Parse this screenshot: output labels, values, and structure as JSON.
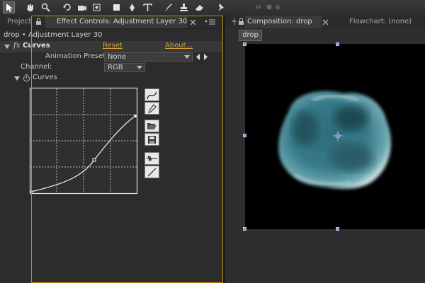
{
  "toolbar": {
    "tools": [
      "selection-tool-icon",
      "hand-tool-icon",
      "zoom-tool-icon",
      "rotate-tool-icon",
      "camera-tool-icon",
      "pan-behind-tool-icon",
      "rectangle-tool-icon",
      "pen-tool-icon",
      "type-tool-icon",
      "brush-tool-icon",
      "clone-stamp-tool-icon",
      "eraser-tool-icon",
      "puppet-pin-tool-icon"
    ]
  },
  "tabs": {
    "project": "Project",
    "effect_controls": "Effect Controls: Adjustment Layer 30",
    "composition": "Composition: drop",
    "flowchart": "Flowchart: (none)"
  },
  "effect_controls": {
    "breadcrumb": "drop • Adjustment Layer 30",
    "effect_name": "Curves",
    "fx": "fx",
    "reset": "Reset",
    "about": "About...",
    "animation_presets_label": "Animation Presets:",
    "animation_presets_value": "None",
    "channel_label": "Channel:",
    "channel_value": "RGB",
    "curves_property": "Curves"
  },
  "composition": {
    "tab_button": "drop"
  },
  "colors": {
    "accent_link": "#d8a43a",
    "panel_border": "#c08c1e",
    "drop_color": "#3d7f8c"
  }
}
